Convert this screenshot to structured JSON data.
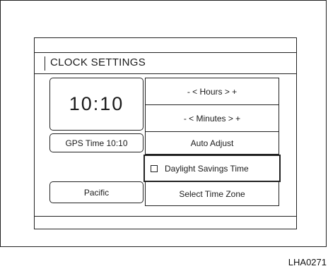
{
  "title": "CLOCK SETTINGS",
  "clock": {
    "time": "10:10",
    "gps_label": "GPS Time  10:10",
    "time_zone": "Pacific"
  },
  "controls": {
    "hours": "- <   Hours   > +",
    "minutes": "- <   Minutes   > +",
    "auto_adjust": "Auto Adjust",
    "daylight_savings": "Daylight Savings Time",
    "select_time_zone": "Select Time Zone"
  },
  "reference_code": "LHA0271"
}
